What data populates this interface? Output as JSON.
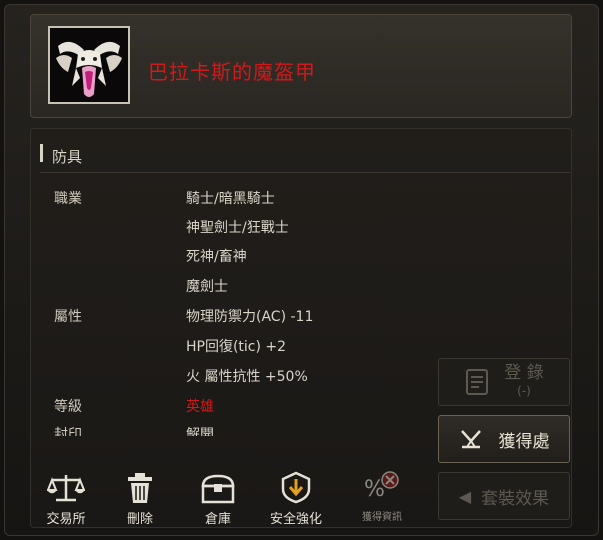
{
  "item": {
    "name": "巴拉卡斯的魔盔甲",
    "icon": "dragon-skull-icon",
    "name_color": "#d01a1a"
  },
  "category": "防具",
  "details": {
    "job_label": "職業",
    "jobs": [
      "騎士/暗黑騎士",
      "神聖劍士/狂戰士",
      "死神/畜神",
      "魔劍士"
    ],
    "attr_label": "屬性",
    "attributes": [
      "物理防禦力(AC) -11",
      "HP回復(tic) +2",
      "火 屬性抗性 +50%"
    ],
    "grade_label": "等級",
    "grade_value": "英雄",
    "seal_label": "封印",
    "seal_value": "解開"
  },
  "side_buttons": {
    "register_label": "登 錄",
    "register_sub": "(-)",
    "obtain_label": "獲得處",
    "set_effect_label": "套裝效果"
  },
  "toolbar": [
    {
      "label": "交易所",
      "icon": "scales-icon"
    },
    {
      "label": "刪除",
      "icon": "trash-icon"
    },
    {
      "label": "倉庫",
      "icon": "chest-icon"
    },
    {
      "label": "安全強化",
      "icon": "enhance-icon"
    },
    {
      "label": "獲得資訊",
      "icon": "percent-disabled-icon"
    }
  ]
}
